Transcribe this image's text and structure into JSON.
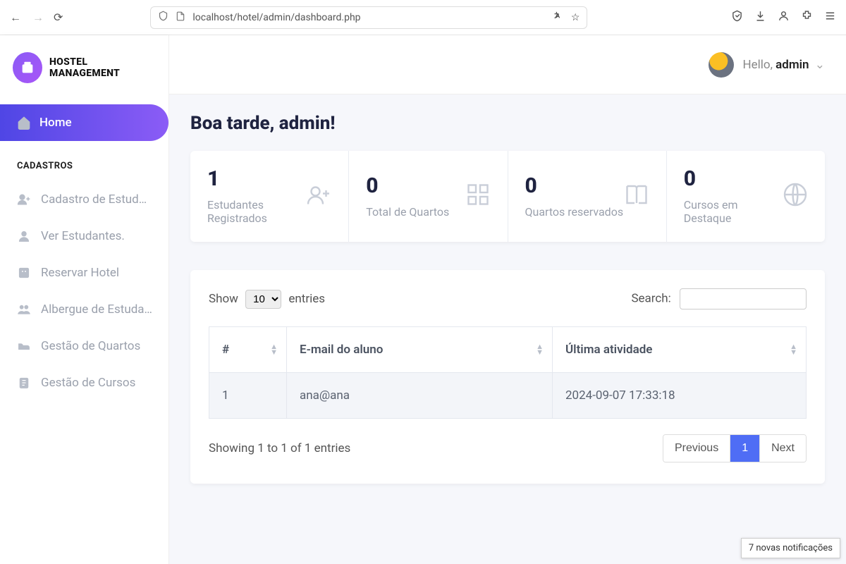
{
  "browser": {
    "url": "localhost/hotel/admin/dashboard.php"
  },
  "brand": {
    "name": "HOSTEL MANAGEMENT"
  },
  "sidebar": {
    "home": "Home",
    "section": "CADASTROS",
    "items": [
      {
        "label": "Cadastro de Estud…"
      },
      {
        "label": "Ver Estudantes."
      },
      {
        "label": "Reservar Hotel"
      },
      {
        "label": "Albergue de Estuda…"
      },
      {
        "label": "Gestão de Quartos"
      },
      {
        "label": "Gestão de Cursos"
      }
    ]
  },
  "topbar": {
    "hello_prefix": "Hello, ",
    "username": "admin"
  },
  "greeting": "Boa tarde, admin!",
  "cards": [
    {
      "value": "1",
      "label": "Estudantes Registrados"
    },
    {
      "value": "0",
      "label": "Total de Quartos"
    },
    {
      "value": "0",
      "label": "Quartos reservados"
    },
    {
      "value": "0",
      "label": "Cursos em Destaque"
    }
  ],
  "datatable": {
    "show_label": "Show",
    "entries_label": "entries",
    "length": "10",
    "search_label": "Search:",
    "search_value": "",
    "columns": [
      "#",
      "E-mail do aluno",
      "Última atividade"
    ],
    "rows": [
      {
        "idx": "1",
        "email": "ana@ana",
        "activity": "2024-09-07 17:33:18"
      }
    ],
    "info": "Showing 1 to 1 of 1 entries",
    "prev": "Previous",
    "page": "1",
    "next": "Next"
  },
  "toast": "7 novas notificações"
}
